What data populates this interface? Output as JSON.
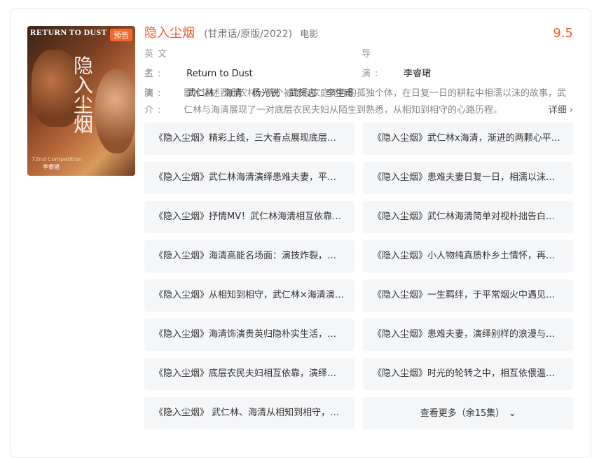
{
  "poster": {
    "title_text": "RETURN TO DUST",
    "calligraphy": "隐入尘烟",
    "badge": "预告",
    "festival": "72nd Competition",
    "director": "李睿珺"
  },
  "movie": {
    "title": "隐入尘烟",
    "subtitle": "(甘肃话/原版/2022)",
    "type": "电影",
    "score": "9.5",
    "english_label": "英文名:",
    "english_name": "Return to Dust",
    "director_label": "导　演:",
    "director": "李睿珺",
    "cast_label": "主　演:",
    "cast": [
      "武仁林",
      "海清",
      "杨光锐",
      "武赟志",
      "李生甫"
    ],
    "intro_label": "简　介:",
    "intro": "影片讲述西北农村，两个被各自家庭抛弃的孤独个体，在日复一日的耕耘中相濡以沫的故事，武仁林与海清展现了一对底层农民夫妇从陌生到熟悉，从相知到相守的心路历程。",
    "more_detail": "详细"
  },
  "episodes": [
    "《隐入尘烟》精彩上线，三大看点展现底层夫妻的质朴爱情",
    "《隐入尘烟》武仁林x海清，渐进的两颗心平淡温暖",
    "《隐入尘烟》武仁林海清演绎患难夫妻，平凡而动人",
    "《隐入尘烟》患难夫妻日复一日，相濡以沫平淡相守",
    "《隐入尘烟》抒情MV！武仁林海清相互依靠共度余生",
    "《隐入尘烟》武仁林海清简单对视朴拙告白，温情动人",
    "《隐入尘烟》海清高能名场面：演技炸裂，妥妥影后",
    "《隐入尘烟》小人物纯真质朴乡土情怀，再续前缘",
    "《隐入尘烟》从相知到相守，武仁林×海清演绎爱情",
    "《隐入尘烟》一生羁绊，于平常烟火中遇见奇迹",
    "《隐入尘烟》海清饰演贵英归隐朴实生活，患难与共",
    "《隐入尘烟》患难夫妻，演绎别样的浪漫与温情",
    "《隐入尘烟》底层农民夫妇相互依靠，演绎乡村爱情",
    "《隐入尘烟》时光的轮转之中，相互依偎温暖彼此",
    "《隐入尘烟》 武仁林、海清从相知到相守，以爱抵御风霜"
  ],
  "see_more": "查看更多（余15集）"
}
